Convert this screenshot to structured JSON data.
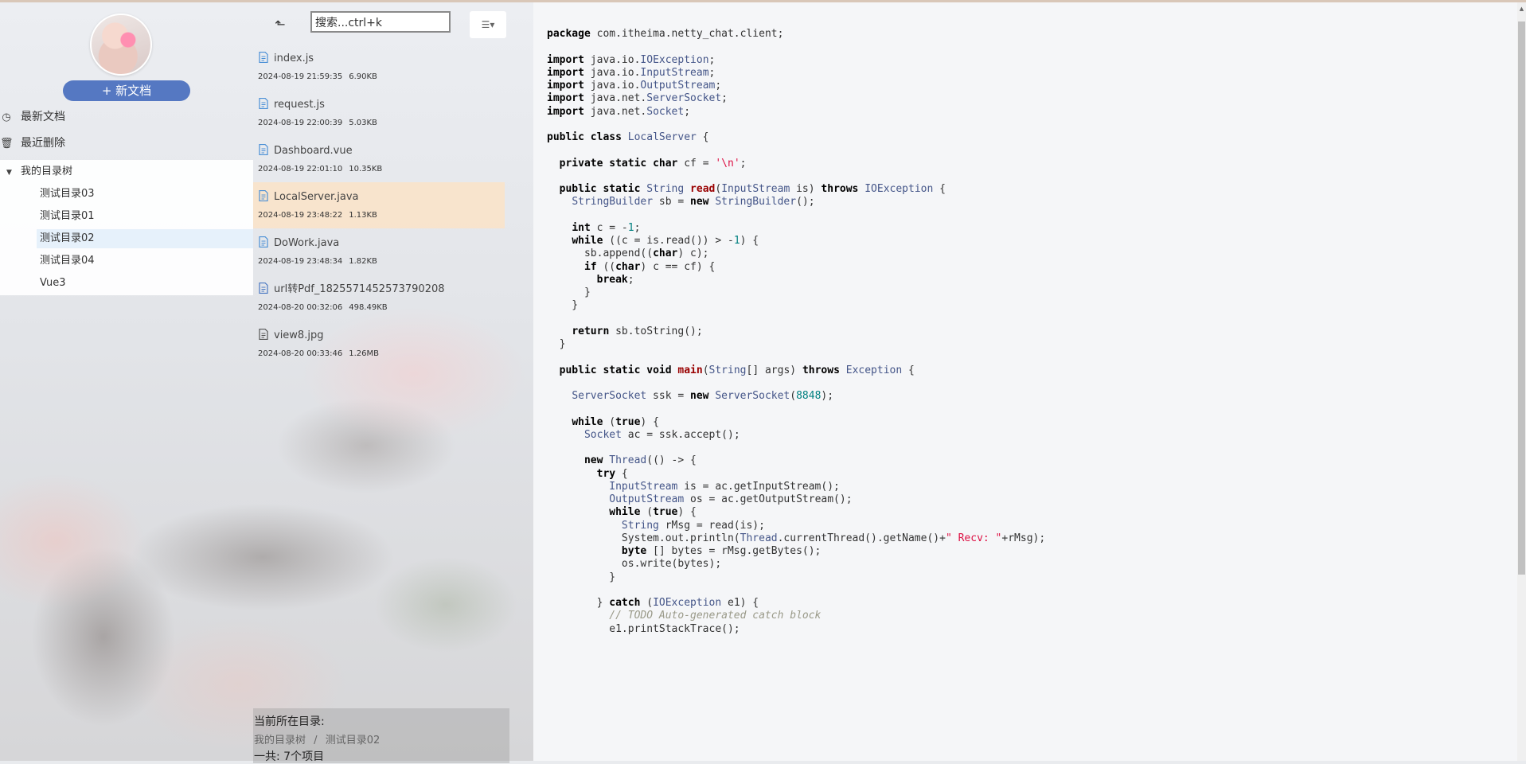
{
  "sidebar": {
    "new_doc_label": "+ 新文档",
    "nav": [
      {
        "label": "最新文档",
        "icon": "clock-icon"
      },
      {
        "label": "最近删除",
        "icon": "trash-icon"
      }
    ],
    "tree": {
      "root_label": "我的目录树",
      "items": [
        {
          "label": "测试目录03"
        },
        {
          "label": "测试目录01"
        },
        {
          "label": "测试目录02",
          "active": true
        },
        {
          "label": "测试目录04"
        },
        {
          "label": "Vue3"
        }
      ]
    }
  },
  "filelist": {
    "search_value": "搜索...ctrl+k",
    "files": [
      {
        "name": "index.js",
        "date": "2024-08-19 21:59:35",
        "size": "6.90KB"
      },
      {
        "name": "request.js",
        "date": "2024-08-19 22:00:39",
        "size": "5.03KB"
      },
      {
        "name": "Dashboard.vue",
        "date": "2024-08-19 22:01:10",
        "size": "10.35KB"
      },
      {
        "name": "LocalServer.java",
        "date": "2024-08-19 23:48:22",
        "size": "1.13KB"
      },
      {
        "name": "DoWork.java",
        "date": "2024-08-19 23:48:34",
        "size": "1.82KB"
      },
      {
        "name": "url转Pdf_1825571452573790208",
        "date": "2024-08-20 00:32:06",
        "size": "498.49KB"
      },
      {
        "name": "view8.jpg",
        "date": "2024-08-20 00:33:46",
        "size": "1.26MB"
      }
    ],
    "status": {
      "current_dir_label": "当前所在目录:",
      "breadcrumb_root": "我的目录树",
      "breadcrumb_sep": "/",
      "breadcrumb_current": "测试目录02",
      "total_label": "一共: 7个项目"
    }
  },
  "editor": {
    "language": "java",
    "code": [
      "package com.itheima.netty_chat.client;",
      "",
      "import java.io.IOException;",
      "import java.io.InputStream;",
      "import java.io.OutputStream;",
      "import java.net.ServerSocket;",
      "import java.net.Socket;",
      "",
      "public class LocalServer {",
      "",
      "  private static char cf = '\\n';",
      "",
      "  public static String read(InputStream is) throws IOException {",
      "    StringBuilder sb = new StringBuilder();",
      "",
      "    int c = -1;",
      "    while ((c = is.read()) > -1) {",
      "      sb.append((char) c);",
      "      if ((char) c == cf) {",
      "        break;",
      "      }",
      "    }",
      "",
      "    return sb.toString();",
      "  }",
      "",
      "  public static void main(String[] args) throws Exception {",
      "",
      "    ServerSocket ssk = new ServerSocket(8848);",
      "",
      "    while (true) {",
      "      Socket ac = ssk.accept();",
      "",
      "      new Thread(() -> {",
      "        try {",
      "          InputStream is = ac.getInputStream();",
      "          OutputStream os = ac.getOutputStream();",
      "          while (true) {",
      "            String rMsg = read(is);",
      "            System.out.println(Thread.currentThread().getName()+\" Recv: \"+rMsg);",
      "            byte [] bytes = rMsg.getBytes();",
      "            os.write(bytes);",
      "          }",
      "",
      "        } catch (IOException e1) {",
      "          // TODO Auto-generated catch block",
      "          e1.printStackTrace();"
    ]
  }
}
